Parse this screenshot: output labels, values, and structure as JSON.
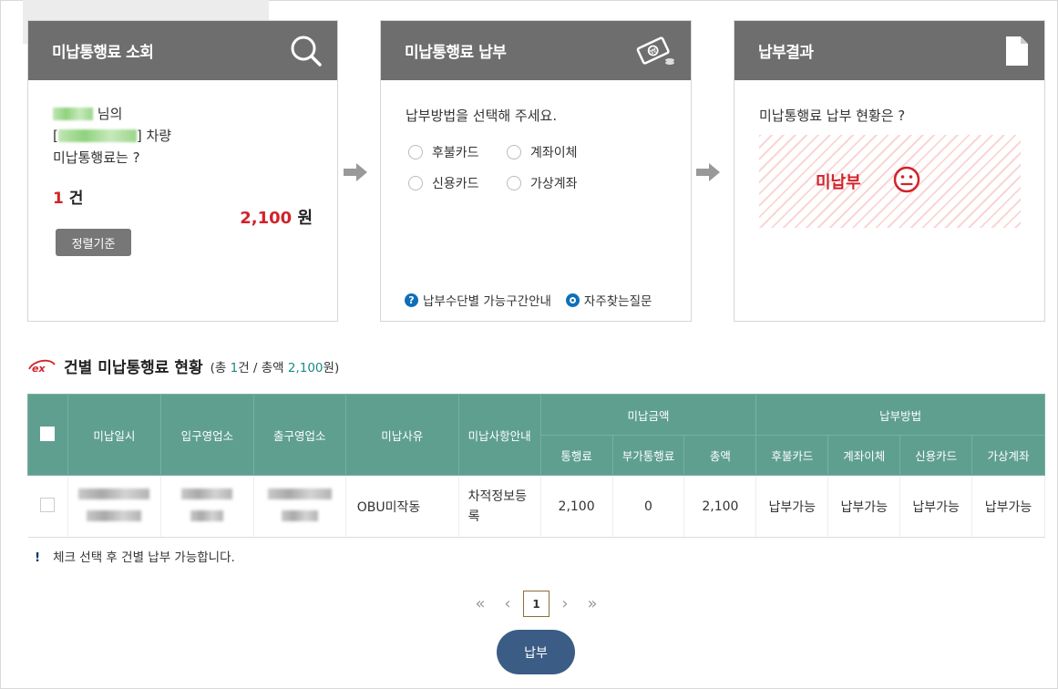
{
  "cards": {
    "inquiry": {
      "title": "미납통행료 소회",
      "owner_suffix": "님의",
      "vehicle_suffix": "차량",
      "question": "미납통행료는 ?",
      "count": "1",
      "count_unit": "건",
      "amount": "2,100",
      "amount_unit": "원",
      "sort_button": "정렬기준"
    },
    "payment": {
      "title": "미납통행료 납부",
      "prompt": "납부방법을 선택해 주세요.",
      "options": [
        "후불카드",
        "계좌이체",
        "신용카드",
        "가상계좌"
      ],
      "link_guide": "납부수단별 가능구간안내",
      "link_faq": "자주찾는질문"
    },
    "result": {
      "title": "납부결과",
      "prompt": "미납통행료 납부 현황은 ?",
      "status": "미납부"
    }
  },
  "section": {
    "logo": "ex",
    "title": "건별 미납통행료 현황",
    "summary_prefix": "(총 ",
    "summary_count": "1",
    "summary_mid": "건 / 총액 ",
    "summary_amount": "2,100",
    "summary_suffix": "원)"
  },
  "table": {
    "headers": {
      "date": "미납일시",
      "entry": "입구영업소",
      "exit": "출구영업소",
      "reason": "미납사유",
      "guide": "미납사항안내",
      "amount_group": "미납금액",
      "toll": "통행료",
      "extra": "부가통행료",
      "total": "총액",
      "method_group": "납부방법",
      "m1": "후불카드",
      "m2": "계좌이체",
      "m3": "신용카드",
      "m4": "가상계좌"
    },
    "rows": [
      {
        "reason": "OBU미작동",
        "guide": "차적정보등록",
        "toll": "2,100",
        "extra": "0",
        "total": "2,100",
        "m1": "납부가능",
        "m2": "납부가능",
        "m3": "납부가능",
        "m4": "납부가능"
      }
    ]
  },
  "notice": {
    "mark": "!",
    "text": "체크 선택 후 건별 납부 가능합니다."
  },
  "pager": {
    "first": "«",
    "prev": "‹",
    "current": "1",
    "next": "›",
    "last": "»"
  },
  "pay_button": "납부",
  "colors": {
    "card_header": "#6f6e6e",
    "table_header": "#5f9f90",
    "accent_red": "#d2232a",
    "button_blue": "#3b5d85"
  }
}
